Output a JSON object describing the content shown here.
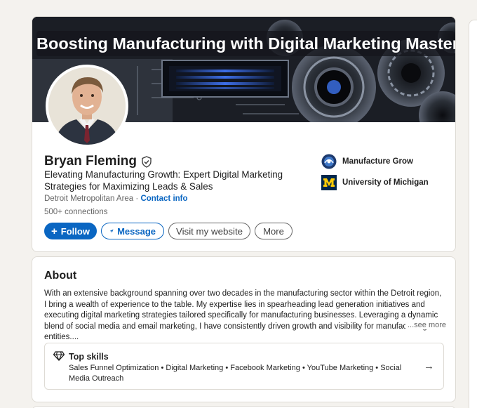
{
  "banner": {
    "title": "Boosting Manufacturing with Digital Marketing Mastery"
  },
  "profile": {
    "name": "Bryan Fleming",
    "headline": "Elevating Manufacturing Growth: Expert Digital Marketing Strategies for Maximizing Leads & Sales",
    "location": "Detroit Metropolitan Area",
    "location_separator": "·",
    "contact_label": "Contact info",
    "connections": "500+ connections"
  },
  "actions": {
    "follow_icon": "+",
    "follow_label": "Follow",
    "message_label": "Message",
    "website_label": "Visit my website",
    "more_label": "More"
  },
  "experience_summary": [
    {
      "label": "Manufacture Grow",
      "icon": "company-logo-icon"
    },
    {
      "label": "University of Michigan",
      "icon": "university-logo-icon"
    }
  ],
  "about": {
    "title": "About",
    "text": "With an extensive background spanning over two decades in the manufacturing sector within the Detroit region, I bring a wealth of experience to the table. My expertise lies in spearheading lead generation initiatives and executing digital marketing strategies tailored specifically for manufacturing businesses. Leveraging a dynamic blend of social media and email marketing, I have consistently driven growth and visibility for manufacturing entities....",
    "see_more": "...see more"
  },
  "skills": {
    "title": "Top skills",
    "list": "Sales Funnel Optimization • Digital Marketing • Facebook Marketing • YouTube Marketing • Social Media Outreach",
    "arrow": "→"
  },
  "colors": {
    "accent": "#0a66c2",
    "background": "#f4f2ee",
    "michigan_blue": "#00274c",
    "michigan_maize": "#ffcb05"
  }
}
